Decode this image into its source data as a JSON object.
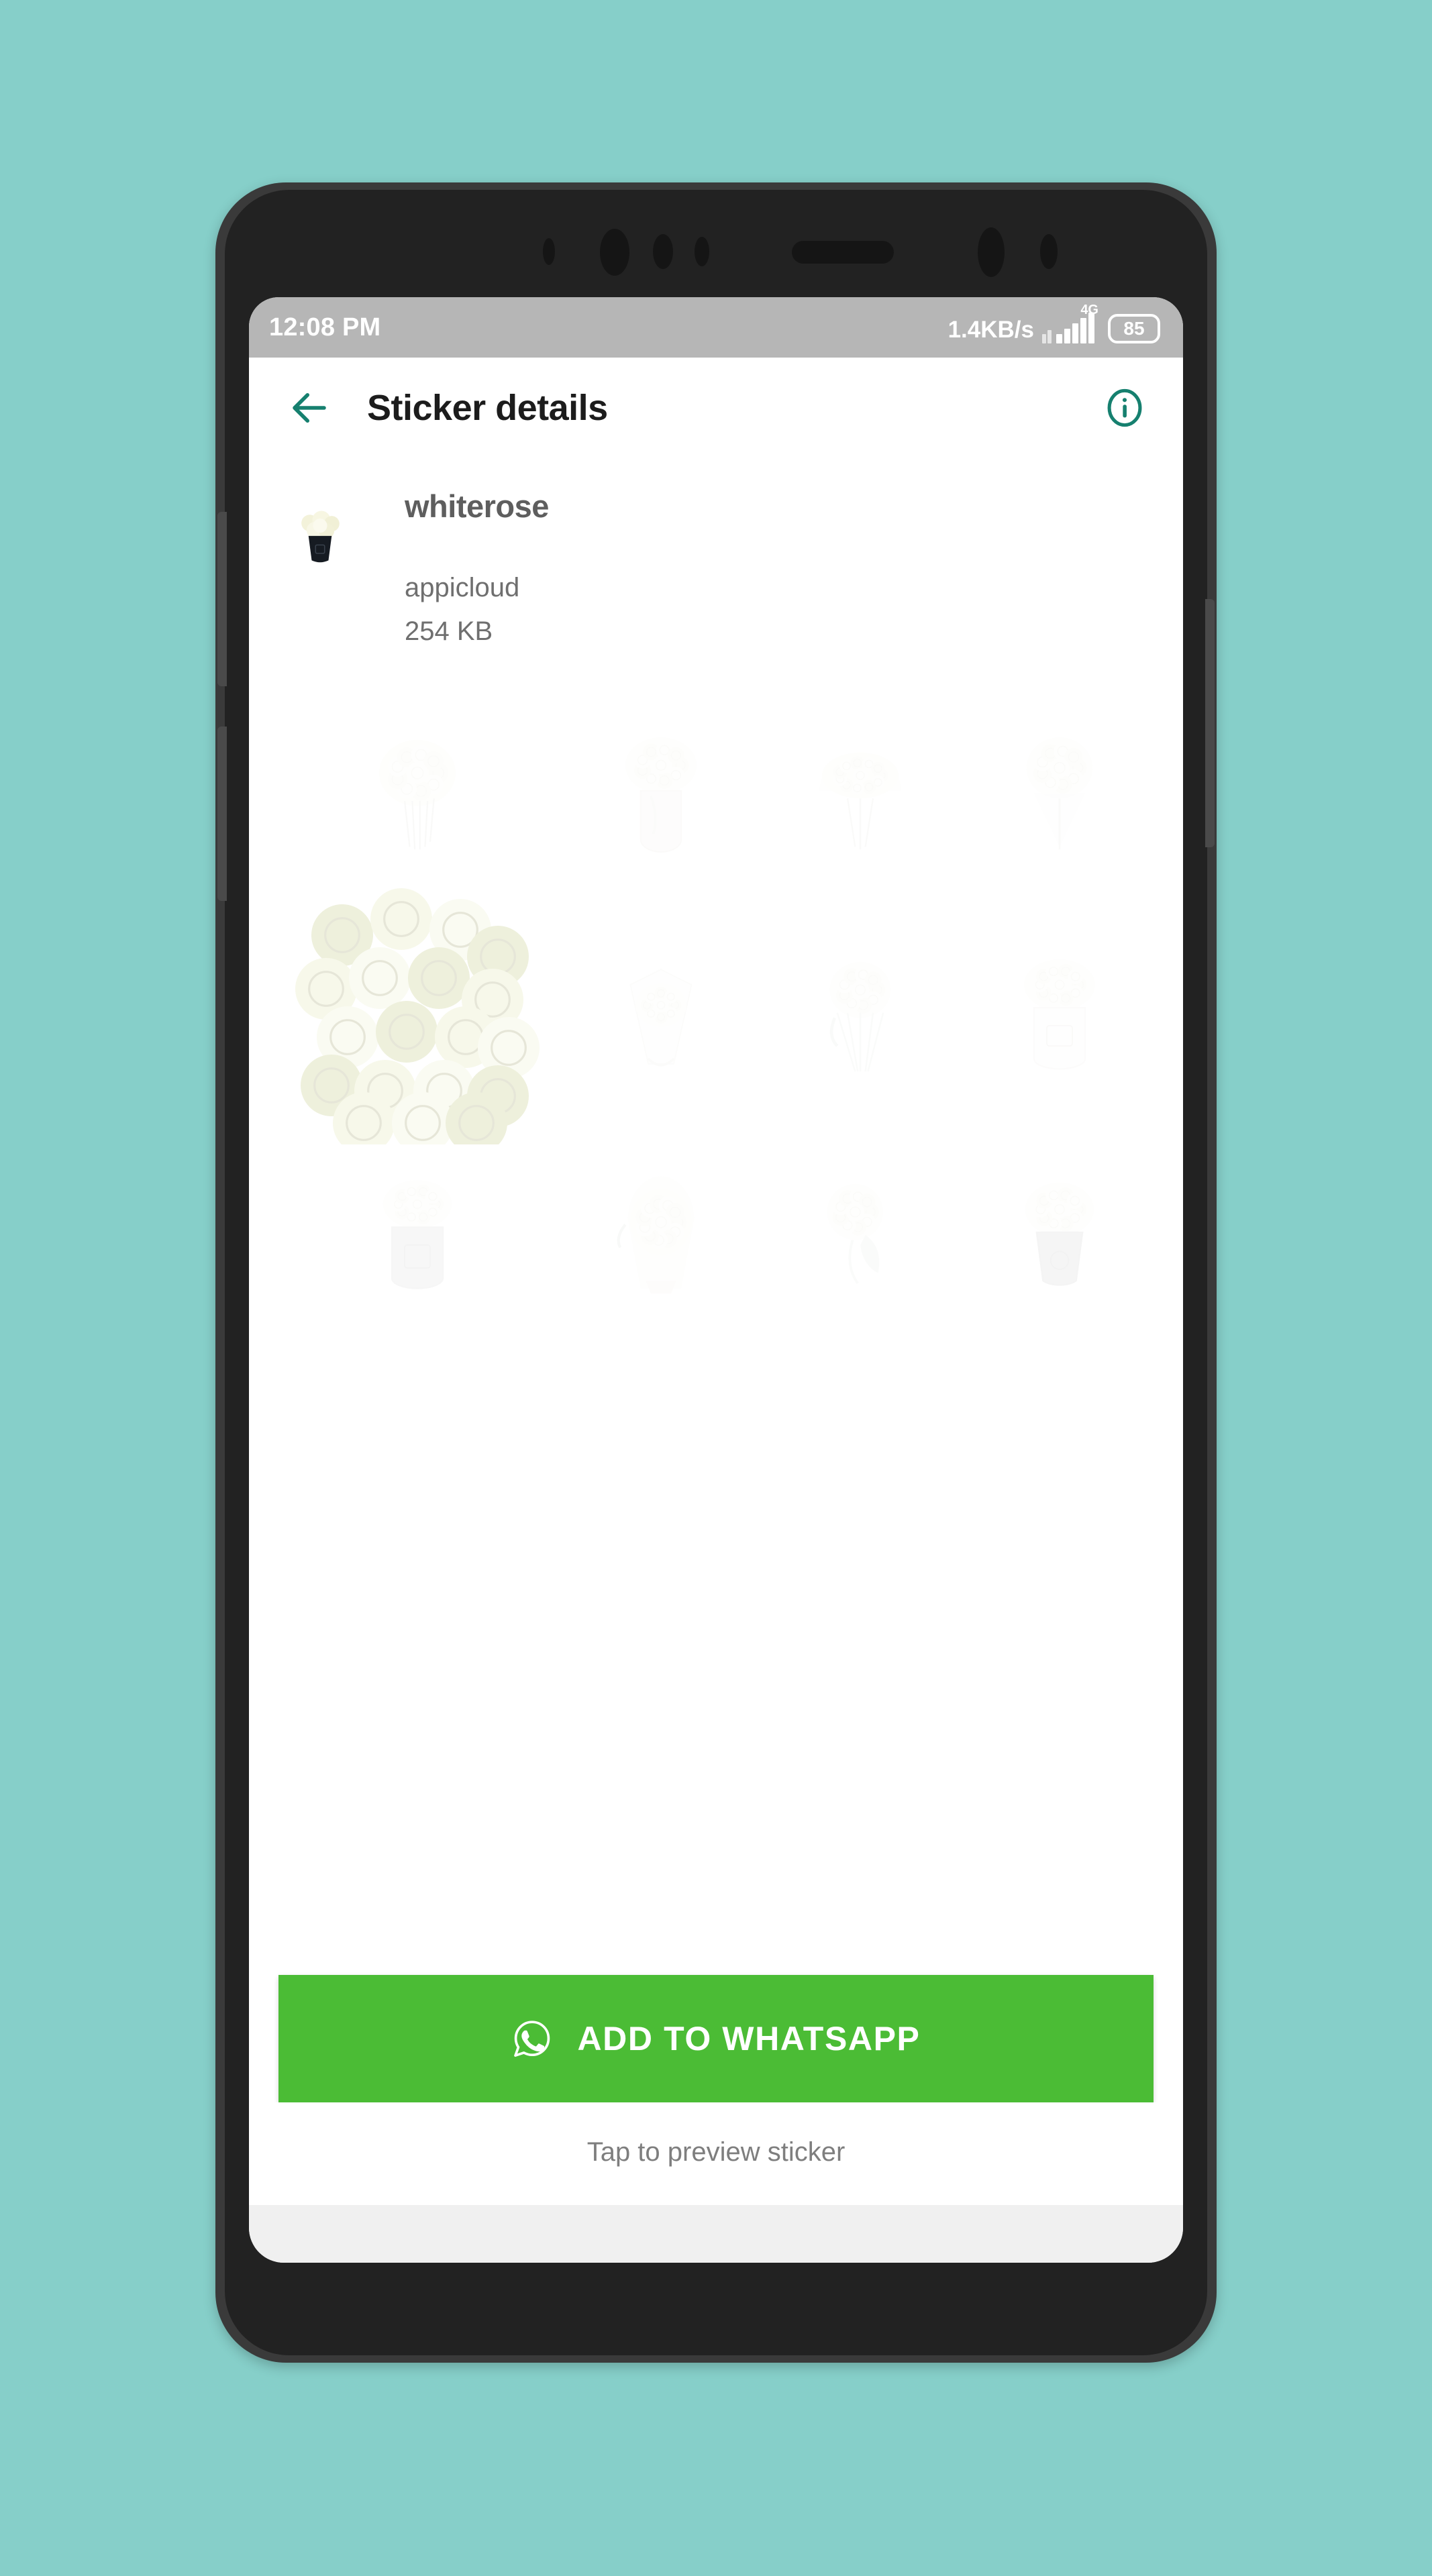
{
  "background_color": "#86cfc9",
  "status_bar": {
    "time": "12:08 PM",
    "network_speed": "1.4KB/s",
    "network_type": "4G",
    "battery_level": "85",
    "signal_icon": "signal-bars-icon",
    "battery_icon": "battery-icon"
  },
  "app_bar": {
    "back_icon": "back-arrow-icon",
    "title": "Sticker details",
    "info_icon": "info-circle-icon",
    "accent_color": "#16806f"
  },
  "pack": {
    "thumbnail_alt": "white-rose-bouquet-thumbnail",
    "name": "whiterose",
    "publisher": "appicloud",
    "size": "254 KB"
  },
  "stickers": [
    {
      "id": 1,
      "alt": "white-rose-bouquet-wrapped",
      "style": "bouquet-stems",
      "pressed": false
    },
    {
      "id": 2,
      "alt": "white-roses-in-vase",
      "style": "vase-tall",
      "pressed": false
    },
    {
      "id": 3,
      "alt": "large-white-rose-dome-bouquet",
      "style": "dome",
      "pressed": false
    },
    {
      "id": 4,
      "alt": "white-tulip-rose-bundle",
      "style": "bundle",
      "pressed": false
    },
    {
      "id": 5,
      "alt": "dense-white-roses-cluster",
      "style": "cluster",
      "pressed": true
    },
    {
      "id": 6,
      "alt": "wrapped-white-rose-bouquet",
      "style": "wrapped-cone",
      "pressed": false
    },
    {
      "id": 7,
      "alt": "white-roses-with-long-stems",
      "style": "long-stems",
      "pressed": false
    },
    {
      "id": 8,
      "alt": "white-roses-in-round-hatbox",
      "style": "hatbox",
      "pressed": false
    },
    {
      "id": 9,
      "alt": "white-roses-in-gray-hatbox",
      "style": "hatbox-gray",
      "pressed": false
    },
    {
      "id": 10,
      "alt": "tall-white-rose-arrangement",
      "style": "tall-spray",
      "pressed": false
    },
    {
      "id": 11,
      "alt": "white-roses-with-greenery",
      "style": "greenery",
      "pressed": false
    },
    {
      "id": 12,
      "alt": "white-roses-in-dark-pot",
      "style": "dark-pot",
      "pressed": false
    }
  ],
  "footer": {
    "button_icon": "whatsapp-icon",
    "button_label": "ADD TO WHATSAPP",
    "button_color": "#4bbc35",
    "hint": "Tap to preview sticker"
  }
}
